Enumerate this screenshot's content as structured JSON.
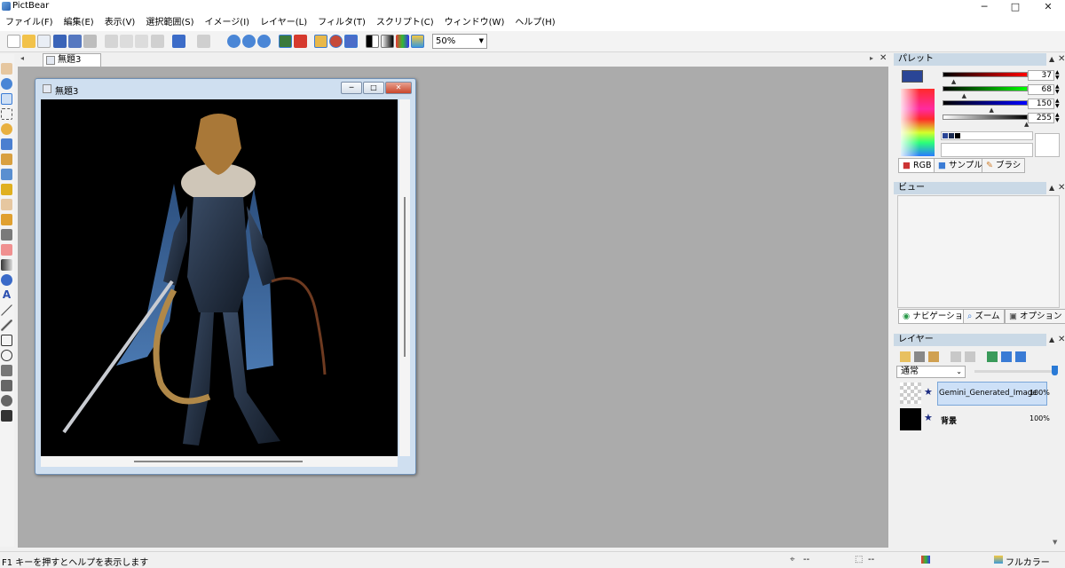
{
  "app": {
    "title": "PictBear"
  },
  "window_controls": {
    "minimize": "─",
    "maximize": "□",
    "close": "✕"
  },
  "menu": [
    "ファイル(F)",
    "編集(E)",
    "表示(V)",
    "選択範囲(S)",
    "イメージ(I)",
    "レイヤー(L)",
    "フィルタ(T)",
    "スクリプト(C)",
    "ウィンドウ(W)",
    "ヘルプ(H)"
  ],
  "toolbar": {
    "zoom": "50%"
  },
  "document": {
    "tab_label": "無題3",
    "window_title": "無題3"
  },
  "palette": {
    "title": "パレット",
    "fg_color": "#2a4596",
    "values": {
      "r": "37",
      "g": "68",
      "b": "150",
      "a": "255"
    },
    "levels": {
      "r": 0.145,
      "g": 0.267,
      "b": 0.588,
      "a": 1.0
    },
    "tabs": [
      "RGB",
      "サンプル",
      "ブラシ"
    ]
  },
  "view": {
    "title": "ビュー",
    "tabs": [
      "ナビゲーション",
      "ズーム",
      "オプション"
    ]
  },
  "layers": {
    "title": "レイヤー",
    "blend_mode": "通常",
    "items": [
      {
        "name": "Gemini_Generated_Image",
        "opacity": "100%",
        "selected": true
      },
      {
        "name": "背景",
        "opacity": "100%",
        "selected": false
      }
    ]
  },
  "status": {
    "help_text": "F1 キーを押すとヘルプを表示します",
    "pos": "--",
    "size": "--",
    "color_mode": "フルカラー"
  }
}
